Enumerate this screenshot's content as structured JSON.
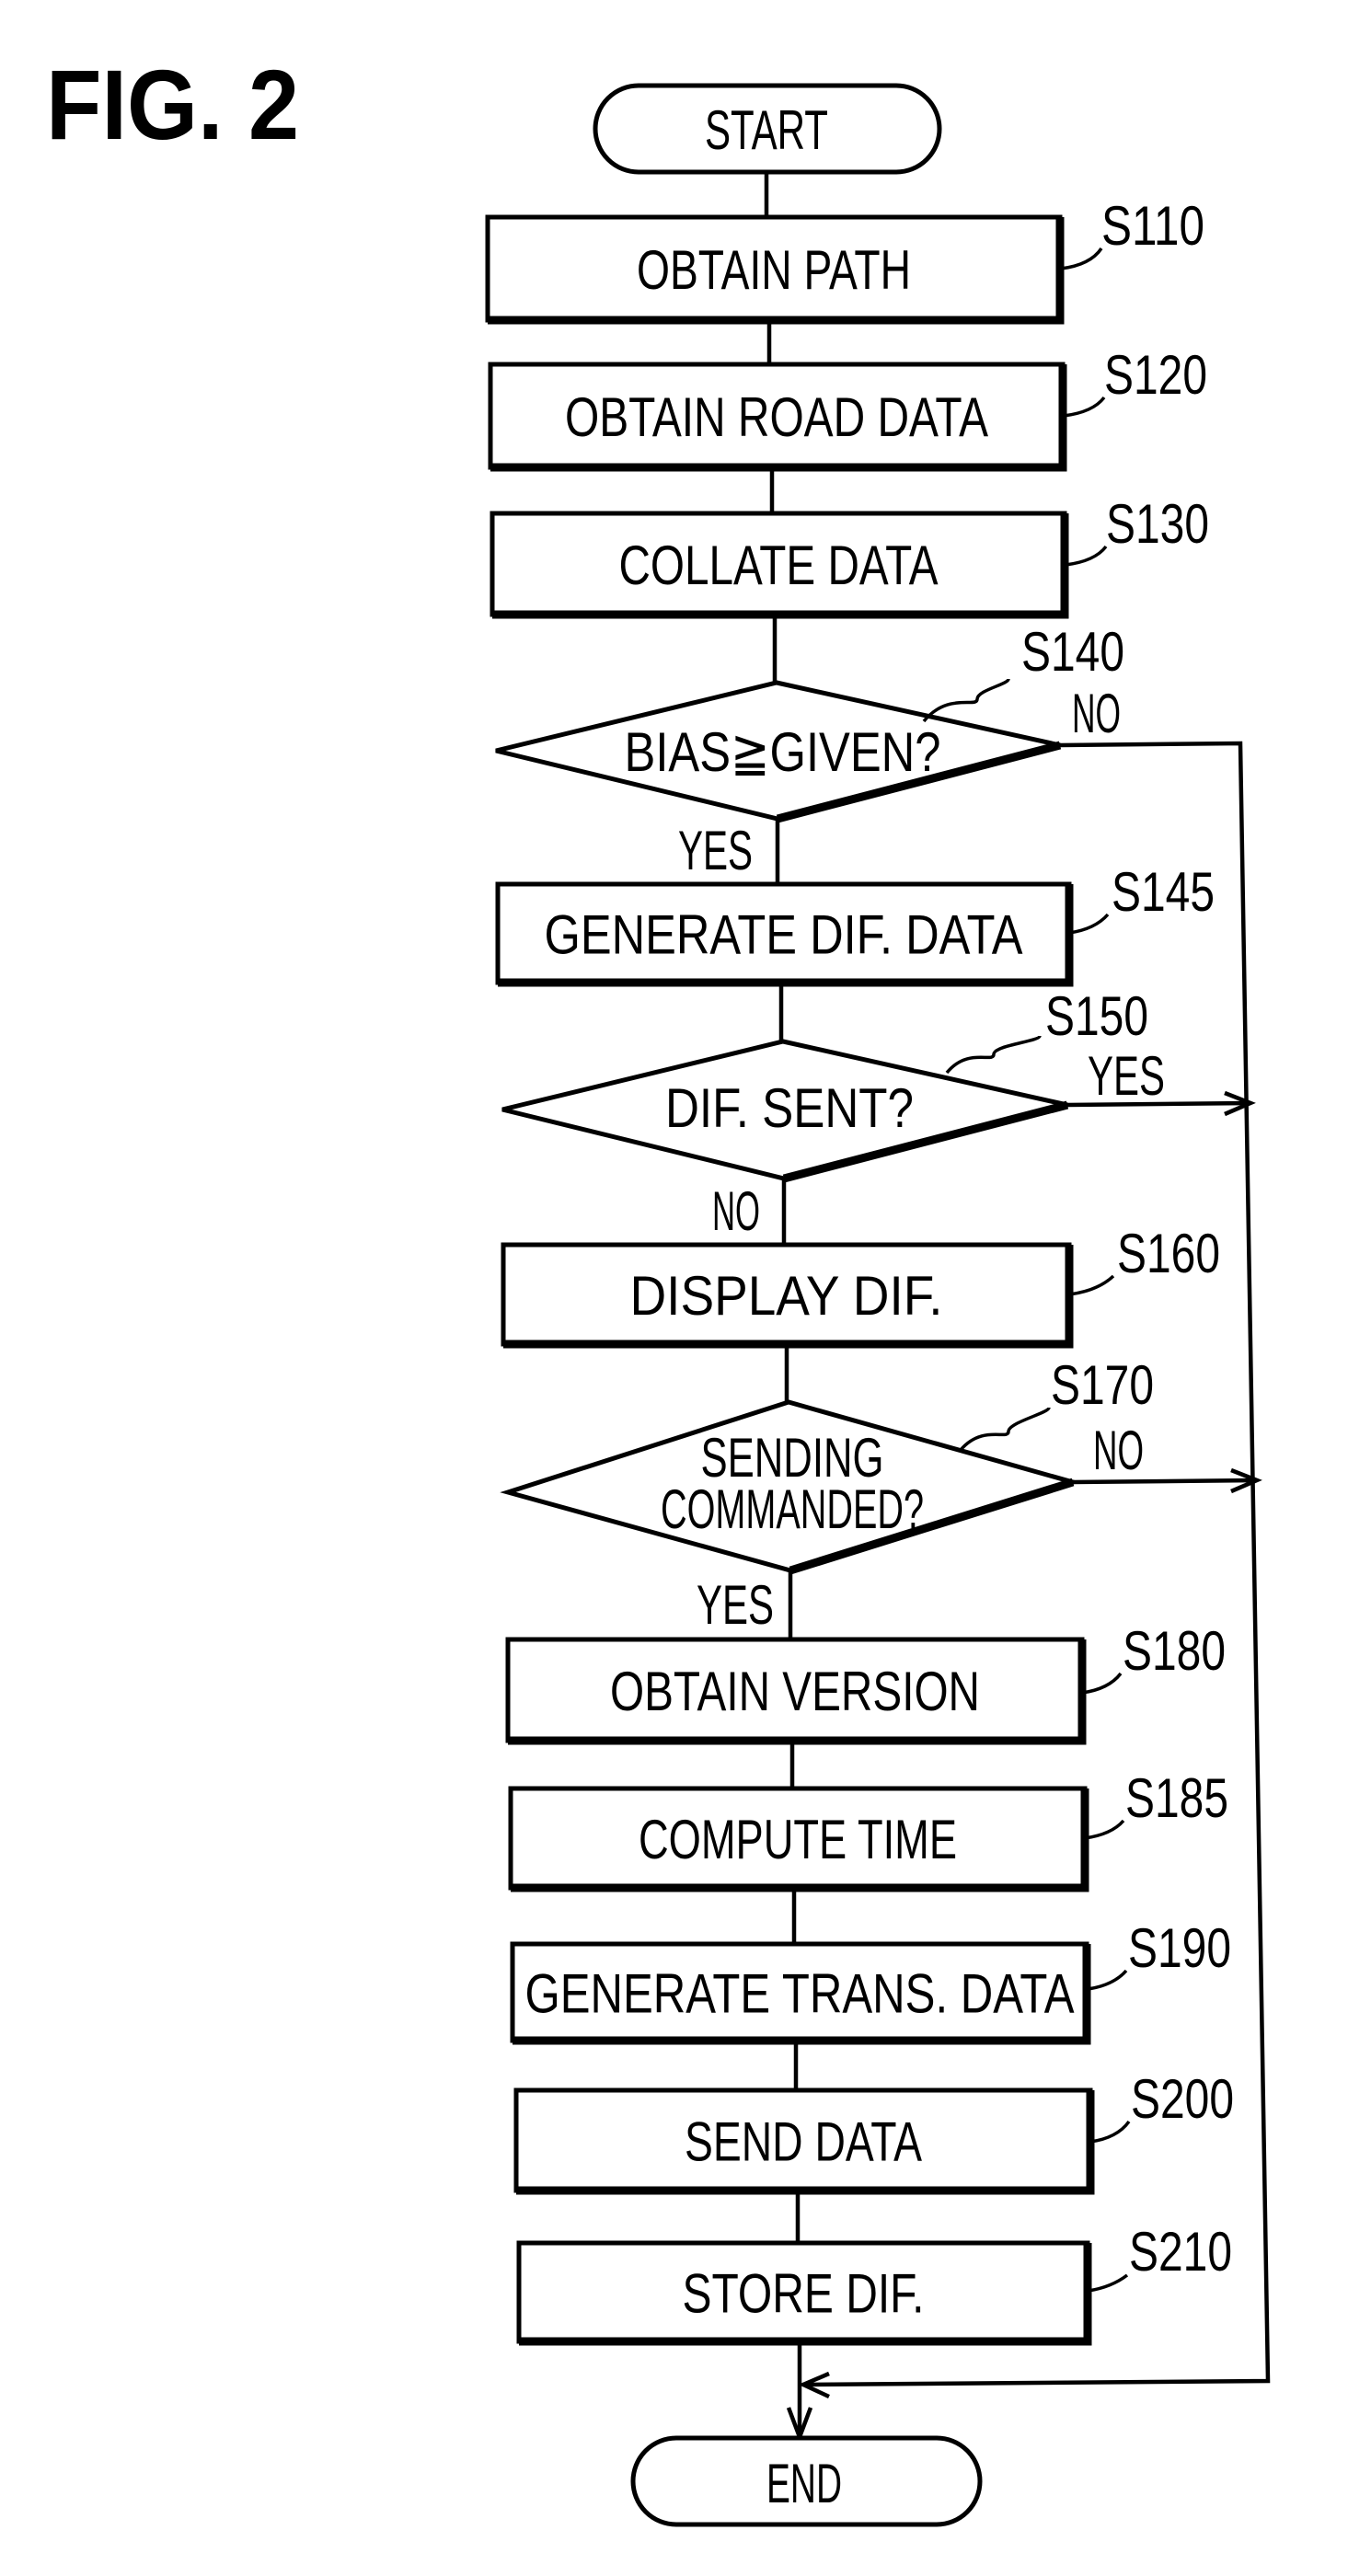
{
  "figure": {
    "title": "FIG. 2"
  },
  "flowchart": {
    "start": {
      "label": "START"
    },
    "end": {
      "label": "END"
    },
    "steps": [
      {
        "id": "S110",
        "type": "process",
        "label": "OBTAIN PATH"
      },
      {
        "id": "S120",
        "type": "process",
        "label": "OBTAIN ROAD DATA"
      },
      {
        "id": "S130",
        "type": "process",
        "label": "COLLATE DATA"
      },
      {
        "id": "S140",
        "type": "decision",
        "label": "BIAS≧GIVEN?",
        "yes_label": "YES",
        "no_label": "NO",
        "yes_target": "S145",
        "no_target": "END"
      },
      {
        "id": "S145",
        "type": "process",
        "label": "GENERATE DIF. DATA"
      },
      {
        "id": "S150",
        "type": "decision",
        "label": "DIF. SENT?",
        "yes_label": "YES",
        "no_label": "NO",
        "yes_target": "END",
        "no_target": "S160"
      },
      {
        "id": "S160",
        "type": "process",
        "label": "DISPLAY DIF."
      },
      {
        "id": "S170",
        "type": "decision",
        "label_lines": [
          "SENDING",
          "COMMANDED?"
        ],
        "yes_label": "YES",
        "no_label": "NO",
        "yes_target": "S180",
        "no_target": "END"
      },
      {
        "id": "S180",
        "type": "process",
        "label": "OBTAIN VERSION"
      },
      {
        "id": "S185",
        "type": "process",
        "label": "COMPUTE TIME"
      },
      {
        "id": "S190",
        "type": "process",
        "label": "GENERATE TRANS. DATA"
      },
      {
        "id": "S200",
        "type": "process",
        "label": "SEND DATA"
      },
      {
        "id": "S210",
        "type": "process",
        "label": "STORE DIF."
      }
    ]
  }
}
